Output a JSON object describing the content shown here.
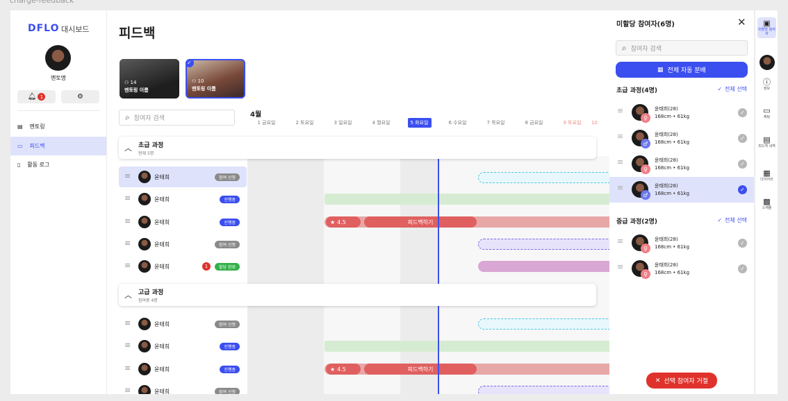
{
  "frame_label": "charge-feedback",
  "brand": {
    "logo": "DFLO",
    "subtitle": "대시보드"
  },
  "profile": {
    "name": "멘토명"
  },
  "notifications": {
    "count": "1"
  },
  "nav": [
    {
      "label": "멘토링",
      "icon": "clipboard-icon"
    },
    {
      "label": "피드백",
      "icon": "feedback-icon"
    },
    {
      "label": "활동 로그",
      "icon": "document-icon"
    }
  ],
  "main": {
    "title": "피드백",
    "cards": [
      {
        "count": "14",
        "title": "멘토링 이름"
      },
      {
        "count": "10",
        "title": "멘토링 이름"
      }
    ],
    "search_placeholder": "참여자 검색",
    "month": "4월",
    "days": [
      "1 금요일",
      "2 토요일",
      "3 일요일",
      "4 월요일",
      "5 화요일",
      "6 수요일",
      "7 목요일",
      "8 금요일",
      "9 토요일",
      "10"
    ],
    "groups": [
      {
        "title": "초급 과정",
        "sub": "현재 5명"
      },
      {
        "title": "고급 과정",
        "sub": "참여중 4명"
      }
    ],
    "participants": [
      {
        "name": "윤태희",
        "status": "참여 신청",
        "status_color": "#8a8a8a"
      },
      {
        "name": "윤태희",
        "status": "진행중",
        "status_color": "#3b4ef0"
      },
      {
        "name": "윤태희",
        "status": "진행중",
        "status_color": "#3b4ef0"
      },
      {
        "name": "윤태희",
        "status": "참여 신청",
        "status_color": "#8a8a8a"
      },
      {
        "name": "윤태희",
        "status": "할당 완료",
        "status_color": "#34b04a",
        "badge": "1"
      },
      {
        "name": "윤태희",
        "status": "참여 신청",
        "status_color": "#8a8a8a"
      },
      {
        "name": "윤태희",
        "status": "진행중",
        "status_color": "#3b4ef0"
      },
      {
        "name": "윤태희",
        "status": "진행중",
        "status_color": "#3b4ef0"
      },
      {
        "name": "윤태희",
        "status": "참여 신청",
        "status_color": "#8a8a8a"
      }
    ],
    "rating": "4.5",
    "feedback_action": "피드백하기"
  },
  "panel": {
    "title": "미할당 참여자(6명)",
    "search_placeholder": "참여자 검색",
    "auto_assign": "전체 자동 분배",
    "select_all": "전체 선택",
    "reject": "선택 참여자 거절",
    "sections": [
      {
        "title": "초급 과정(4명)",
        "members": [
          {
            "name": "윤태희(28)",
            "detail": "168cm • 61kg",
            "gender": "♀",
            "gender_color": "#ef7f86",
            "checked": false
          },
          {
            "name": "윤태희(28)",
            "detail": "168cm • 61kg",
            "gender": "♂",
            "gender_color": "#6b78ec",
            "checked": false
          },
          {
            "name": "윤태희(28)",
            "detail": "168cm • 61kg",
            "gender": "♀",
            "gender_color": "#ef7f86",
            "checked": false
          },
          {
            "name": "윤태희(28)",
            "detail": "168cm • 61kg",
            "gender": "♂",
            "gender_color": "#6b78ec",
            "checked": true
          }
        ]
      },
      {
        "title": "중급 과정(2명)",
        "members": [
          {
            "name": "윤태희(28)",
            "detail": "168cm • 61kg",
            "gender": "♀",
            "gender_color": "#ef7f86",
            "checked": false
          },
          {
            "name": "윤태희(28)",
            "detail": "168cm • 61kg",
            "gender": "♀",
            "gender_color": "#ef7f86",
            "checked": false
          }
        ]
      }
    ]
  },
  "rail": [
    {
      "label": "미할당 참여자",
      "icon": "user-list-icon"
    },
    {
      "label": "정보",
      "icon": "info-icon"
    },
    {
      "label": "채팅",
      "icon": "chat-icon"
    },
    {
      "label": "피드백 내역",
      "icon": "inbox-icon"
    },
    {
      "label": "다이어리",
      "icon": "calendar-icon"
    },
    {
      "label": "스케쥴",
      "icon": "schedule-icon"
    }
  ],
  "colors": {
    "accent": "#3b4ef0",
    "danger": "#e0322c"
  }
}
